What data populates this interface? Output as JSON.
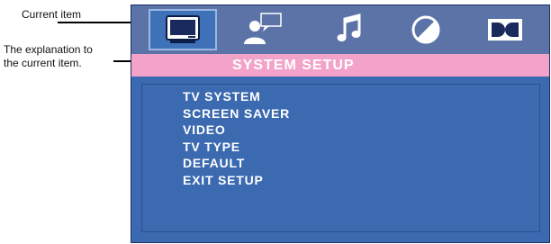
{
  "annotations": {
    "current_item": "Current item",
    "explanation_line1": "The explanation to",
    "explanation_line2": "the current item."
  },
  "osd": {
    "title": "SYSTEM SETUP",
    "tabs": [
      {
        "icon": "monitor-icon",
        "active": true
      },
      {
        "icon": "person-speech-icon",
        "active": false
      },
      {
        "icon": "music-note-icon",
        "active": false
      },
      {
        "icon": "contrast-circle-icon",
        "active": false
      },
      {
        "icon": "dolby-icon",
        "active": false
      }
    ],
    "menu": [
      "TV SYSTEM",
      "SCREEN SAVER",
      "VIDEO",
      "TV TYPE",
      "DEFAULT",
      "EXIT SETUP"
    ]
  },
  "colors": {
    "panel": "#3b6ab0",
    "icon_bar": "#5c73a8",
    "title_bar": "#f3a3c9",
    "text": "#ffffff"
  }
}
